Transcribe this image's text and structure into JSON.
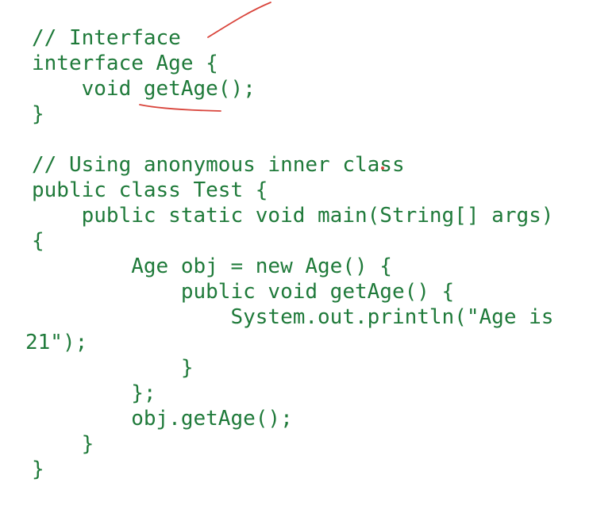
{
  "colors": {
    "background": "#ffffff",
    "code_text": "#1f7a3a",
    "pen_annotation": "#d9443b"
  },
  "code_lines": [
    "// Interface",
    "interface Age {",
    "    void getAge();",
    "}",
    "",
    "// Using anonymous inner class",
    "public class Test {",
    "    public static void main(String[] args)",
    "{",
    "        Age obj = new Age() {",
    "            public void getAge() {",
    "                System.out.println(\"Age is",
    "21\");",
    "            }",
    "        };",
    "        obj.getAge();",
    "    }",
    "}"
  ]
}
